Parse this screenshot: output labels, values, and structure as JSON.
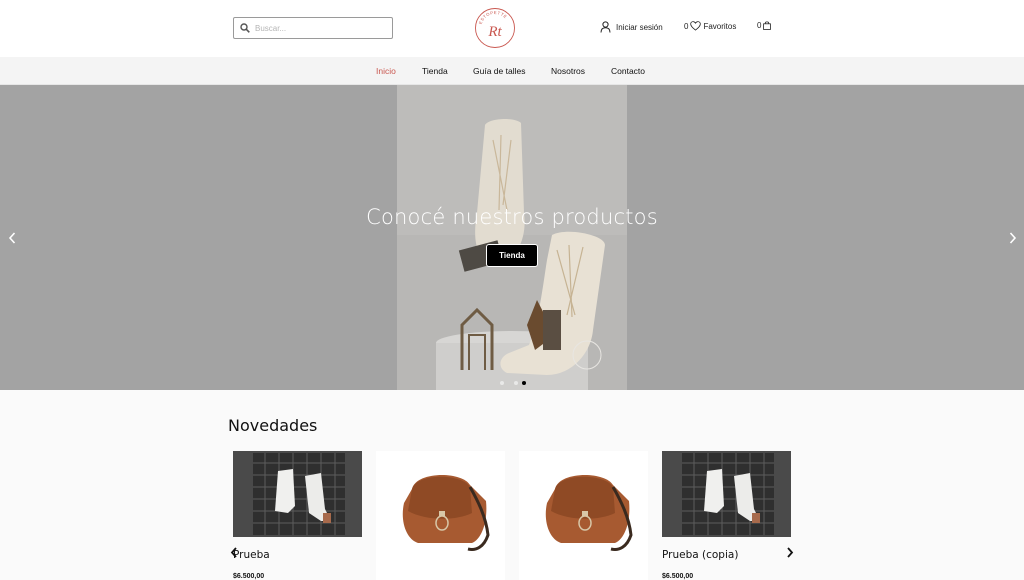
{
  "header": {
    "search_placeholder": "Buscar...",
    "login_label": "Iniciar sesión",
    "favorites_count": "0",
    "favorites_label": "Favoritos",
    "cart_count": "0",
    "logo_text": "ESTOPETTE",
    "logo_initials": "Rt"
  },
  "nav": {
    "items": [
      {
        "label": "Inicio",
        "active": true
      },
      {
        "label": "Tienda"
      },
      {
        "label": "Guía de talles"
      },
      {
        "label": "Nosotros"
      },
      {
        "label": "Contacto"
      }
    ]
  },
  "hero": {
    "title": "Conocé nuestros productos",
    "button_label": "Tienda",
    "slide_count": 2,
    "active_slide": 2
  },
  "novedades": {
    "title": "Novedades",
    "products": [
      {
        "name": "Prueba",
        "price": "$6.500,00",
        "image": "boots-photo"
      },
      {
        "name": "",
        "price": "",
        "image": "leather-bag-photo"
      },
      {
        "name": "",
        "price": "",
        "image": "leather-bag-photo"
      },
      {
        "name": "Prueba (copia)",
        "price": "$6.500,00",
        "image": "boots-photo"
      }
    ]
  },
  "colors": {
    "accent": "#c9574f",
    "hero_overlay": "#a3a3a3",
    "nav_bg": "#f4f4f4"
  }
}
